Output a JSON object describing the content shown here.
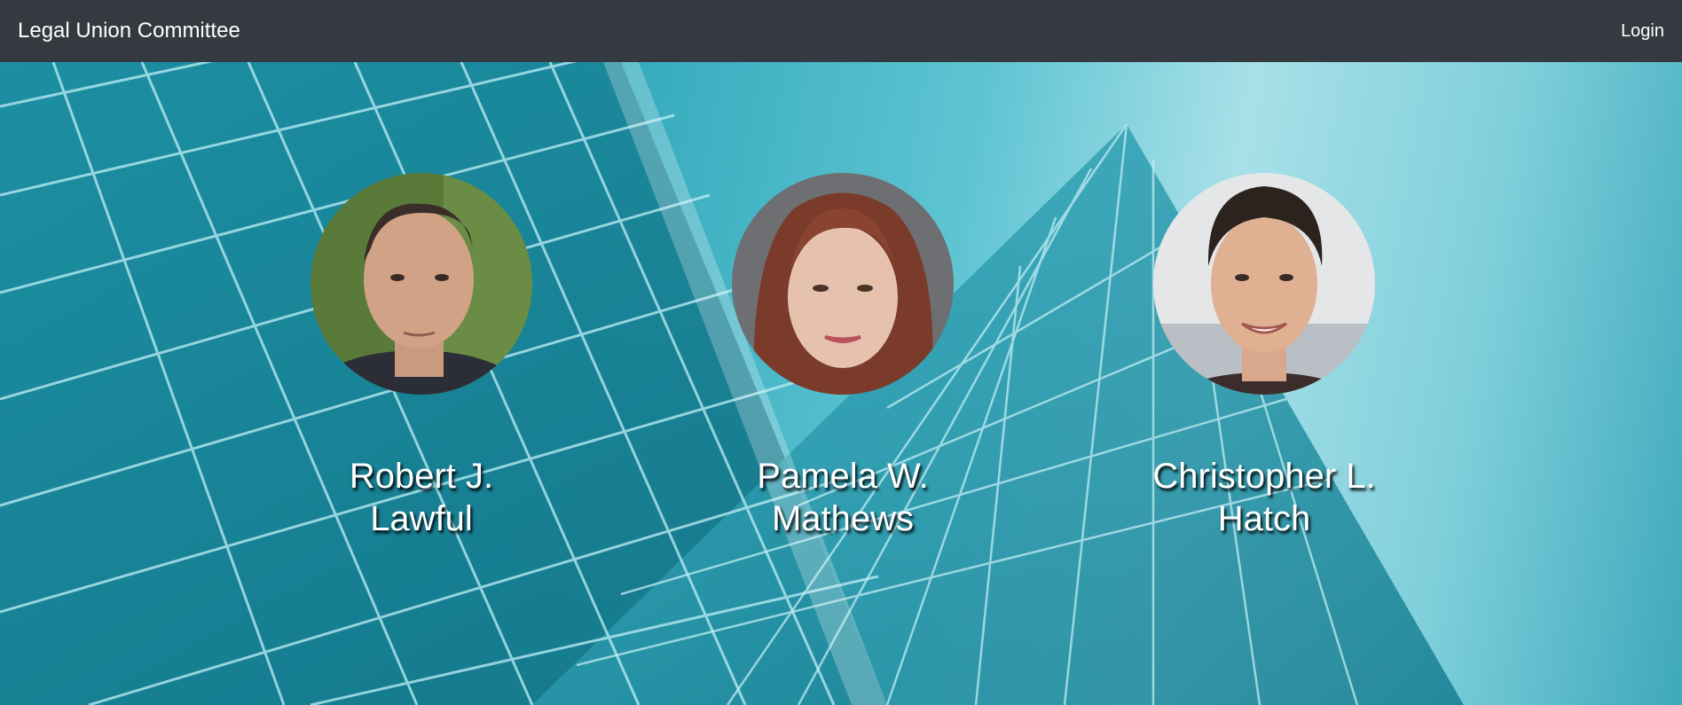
{
  "navbar": {
    "brand": "Legal Union Committee",
    "login_label": "Login"
  },
  "members": [
    {
      "name": "Robert J. Lawful",
      "photo": "man-balding-portrait"
    },
    {
      "name": "Pamela W. Mathews",
      "photo": "woman-red-hair-portrait"
    },
    {
      "name": "Christopher L. Hatch",
      "photo": "young-man-smiling-portrait"
    }
  ],
  "hero": {
    "background": "glass-skyscraper-photo"
  }
}
